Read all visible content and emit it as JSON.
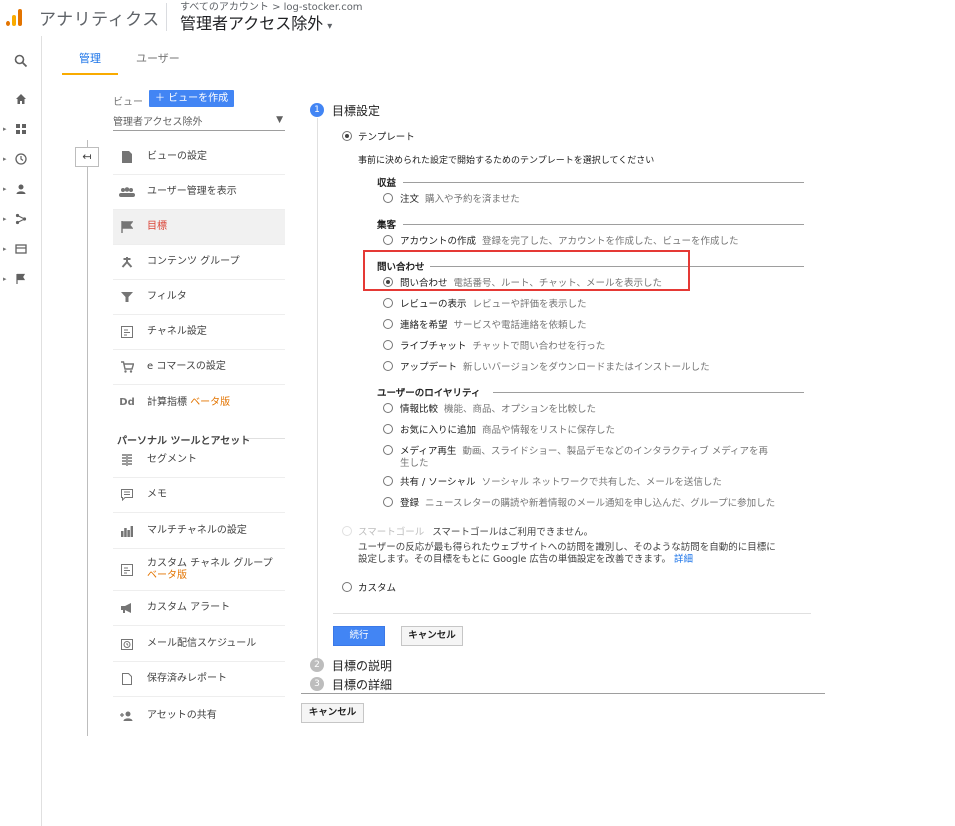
{
  "header": {
    "app_title": "アナリティクス",
    "account_path": "すべてのアカウント > log-stocker.com",
    "view_title": "管理者アクセス除外",
    "view_caret": "▾"
  },
  "rail": {
    "icons": [
      "search-icon",
      "home-icon",
      "dashboard-icon",
      "clock-icon",
      "person-icon",
      "share-icon",
      "window-icon",
      "flag-icon"
    ]
  },
  "tabs": {
    "admin": "管理",
    "user": "ユーザー"
  },
  "view_column": {
    "label": "ビュー",
    "create_button": "＋ ビューを作成",
    "selected_view": "管理者アクセス除外",
    "back_icon": "↤",
    "items": [
      {
        "icon": "doc-icon",
        "label": "ビューの設定"
      },
      {
        "icon": "users-icon",
        "label": "ユーザー管理を表示"
      },
      {
        "icon": "flag-icon",
        "label": "目標"
      },
      {
        "icon": "content-group-icon",
        "label": "コンテンツ グループ"
      },
      {
        "icon": "filter-icon",
        "label": "フィルタ"
      },
      {
        "icon": "channel-icon",
        "label": "チャネル設定"
      },
      {
        "icon": "cart-icon",
        "label": "e コマースの設定"
      },
      {
        "icon": "dd-icon",
        "label": "計算指標",
        "beta": "ベータ版"
      }
    ],
    "personal_header": "パーソナル ツールとアセット",
    "personal_items": [
      {
        "icon": "segment-icon",
        "label": "セグメント"
      },
      {
        "icon": "memo-icon",
        "label": "メモ"
      },
      {
        "icon": "bar-chart-icon",
        "label": "マルチチャネルの設定"
      },
      {
        "icon": "channel-group-icon",
        "label": "カスタム チャネル グループ",
        "beta": "ベータ版"
      },
      {
        "icon": "megaphone-icon",
        "label": "カスタム アラート"
      },
      {
        "icon": "schedule-icon",
        "label": "メール配信スケジュール"
      },
      {
        "icon": "report-icon",
        "label": "保存済みレポート"
      },
      {
        "icon": "add-person-icon",
        "label": "アセットの共有"
      }
    ]
  },
  "goal_setup": {
    "step1": {
      "num": "1",
      "title": "目標設定"
    },
    "step2": {
      "num": "2",
      "title": "目標の説明"
    },
    "step3": {
      "num": "3",
      "title": "目標の詳細"
    },
    "template_label": "テンプレート",
    "template_desc": "事前に決められた設定で開始するためのテンプレートを選択してください",
    "groups": {
      "revenue": {
        "title": "収益",
        "options": [
          {
            "label": "注文",
            "desc": "購入や予約を済ませた"
          }
        ]
      },
      "acquisition": {
        "title": "集客",
        "options": [
          {
            "label": "アカウントの作成",
            "desc": "登録を完了した、アカウントを作成した、ビューを作成した"
          }
        ]
      },
      "inquiry": {
        "title": "問い合わせ",
        "options": [
          {
            "label": "問い合わせ",
            "desc": "電話番号、ルート、チャット、メールを表示した"
          },
          {
            "label": "レビューの表示",
            "desc": "レビューや評価を表示した"
          },
          {
            "label": "連絡を希望",
            "desc": "サービスや電話連絡を依頼した"
          },
          {
            "label": "ライブチャット",
            "desc": "チャットで問い合わせを行った"
          },
          {
            "label": "アップデート",
            "desc": "新しいバージョンをダウンロードまたはインストールした"
          }
        ]
      },
      "loyalty": {
        "title": "ユーザーのロイヤリティ",
        "options": [
          {
            "label": "情報比較",
            "desc": "機能、商品、オプションを比較した"
          },
          {
            "label": "お気に入りに追加",
            "desc": "商品や情報をリストに保存した"
          },
          {
            "label": "メディア再生",
            "desc": "動画、スライドショー、製品デモなどのインタラクティブ メディアを再",
            "desc2": "生した"
          },
          {
            "label": "共有 / ソーシャル",
            "desc": "ソーシャル ネットワークで共有した、メールを送信した"
          },
          {
            "label": "登録",
            "desc": "ニュースレターの購読や新着情報のメール通知を申し込んだ、グループに参加した"
          }
        ]
      }
    },
    "smart_goal": {
      "label": "スマートゴール",
      "status": "スマートゴールはご利用できません。",
      "desc1": "ユーザーの反応が最も得られたウェブサイトへの訪問を識別し、そのような訪問を自動的に目標に",
      "desc2": "設定します。その目標をもとに Google 広告の単価設定を改善できます。",
      "link": "詳細"
    },
    "custom_label": "カスタム",
    "continue_button": "続行",
    "cancel_button": "キャンセル",
    "bottom_cancel_button": "キャンセル"
  },
  "colors": {
    "accent": "#4285f4",
    "active": "#db4437",
    "beta": "#e37400",
    "highlight": "#e53935",
    "logo_orange": "#f9ab00",
    "logo_dark": "#e37400"
  }
}
